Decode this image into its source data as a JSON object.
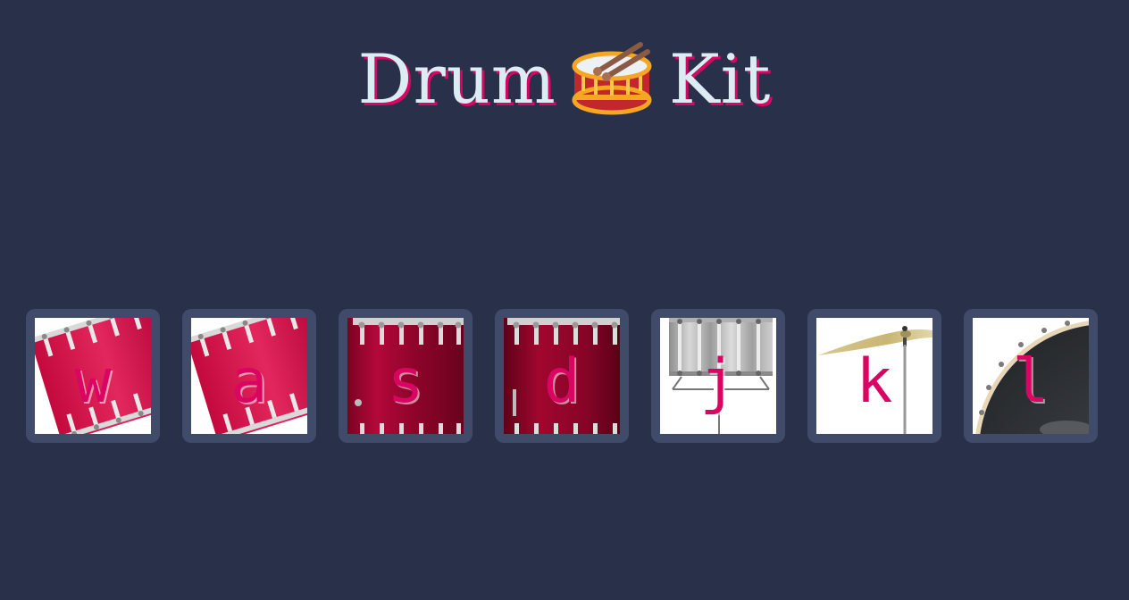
{
  "header": {
    "title_left": "Drum",
    "title_right": "Kit",
    "emoji_icon": "drum-icon"
  },
  "colors": {
    "background": "#283149",
    "key_border": "#404b69",
    "accent": "#da0463",
    "title_text": "#dbedf3"
  },
  "keys": [
    {
      "letter": "w",
      "instrument_icon": "crash-drum-icon"
    },
    {
      "letter": "a",
      "instrument_icon": "kick-drum-icon"
    },
    {
      "letter": "s",
      "instrument_icon": "snare-drum-icon"
    },
    {
      "letter": "d",
      "instrument_icon": "tom-drum-icon"
    },
    {
      "letter": "j",
      "instrument_icon": "snare-steel-icon"
    },
    {
      "letter": "k",
      "instrument_icon": "cymbal-icon"
    },
    {
      "letter": "l",
      "instrument_icon": "bass-drum-icon"
    }
  ]
}
